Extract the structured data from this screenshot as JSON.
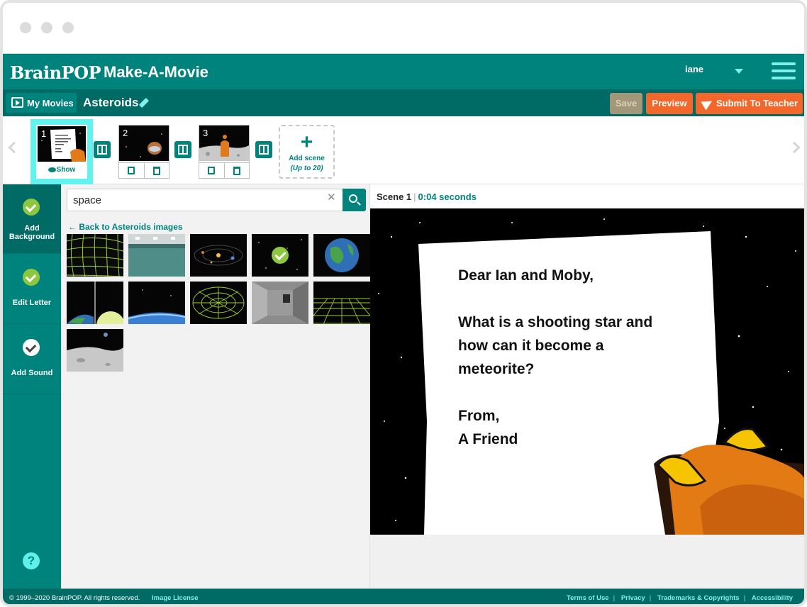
{
  "app": {
    "logo": "BrainPOP",
    "title": "Make-A-Movie",
    "user": "iane"
  },
  "toolbar": {
    "my_movies": "My Movies",
    "movie_title": "Asteroids",
    "save": "Save",
    "preview": "Preview",
    "submit": "Submit To Teacher"
  },
  "scenes": [
    {
      "number": "1",
      "action": "Show"
    },
    {
      "number": "2"
    },
    {
      "number": "3"
    }
  ],
  "add_scene": {
    "label": "Add scene",
    "sub": "(Up to 20)"
  },
  "steps": [
    {
      "label": "Add Background",
      "status": "complete",
      "color": "#8dc63f"
    },
    {
      "label": "Edit Letter",
      "status": "complete",
      "color": "#8dc63f"
    },
    {
      "label": "Add Sound",
      "status": "pending",
      "color": "#ffffff"
    }
  ],
  "help": "?",
  "library": {
    "search_value": "space",
    "back_link": "← Back to Asteroids images",
    "images": [
      {
        "name": "green-wireframe-grid"
      },
      {
        "name": "spaceship-interior"
      },
      {
        "name": "solar-system"
      },
      {
        "name": "starfield",
        "selected": true
      },
      {
        "name": "earth-from-space"
      },
      {
        "name": "earth-and-moon-split"
      },
      {
        "name": "earth-horizon"
      },
      {
        "name": "green-wormhole"
      },
      {
        "name": "space-station-corridor"
      },
      {
        "name": "green-grid-horizon"
      },
      {
        "name": "moon-surface"
      }
    ]
  },
  "stage": {
    "scene_label": "Scene 1",
    "duration": "0:04 seconds",
    "letter": [
      "Dear Ian and Moby,",
      "",
      "What is a shooting star and",
      "how can it become a",
      "meteorite?",
      "",
      "From,",
      "A Friend"
    ]
  },
  "footer": {
    "copyright": "© 1999–2020 BrainPOP. All rights reserved.",
    "image_license": "Image License",
    "links": [
      "Terms of Use",
      "Privacy",
      "Trademarks & Copyrights",
      "Accessibility"
    ]
  },
  "colors": {
    "brand_teal": "#00837d",
    "dark_teal": "#006a65",
    "accent_cyan": "#62f2f0",
    "orange": "#f4672a",
    "check_green": "#8dc63f"
  }
}
